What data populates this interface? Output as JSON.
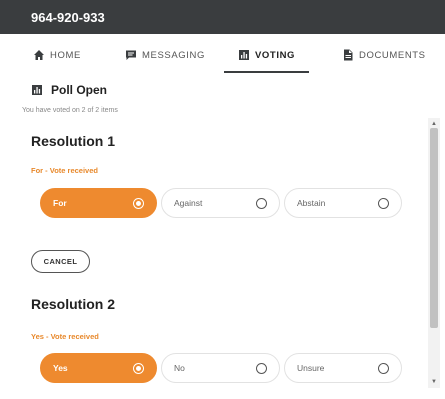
{
  "window": {
    "title": "964-920-933"
  },
  "tabs": [
    {
      "label": "HOME",
      "icon": "home-icon"
    },
    {
      "label": "MESSAGING",
      "icon": "chat-icon"
    },
    {
      "label": "VOTING",
      "icon": "bar-chart-icon",
      "active": true
    },
    {
      "label": "DOCUMENTS",
      "icon": "document-icon"
    }
  ],
  "poll": {
    "status": "Poll Open",
    "voted_note": "You have voted on 2 of 2 items",
    "accent_color": "#ee8a2f"
  },
  "resolutions": [
    {
      "title": "Resolution 1",
      "status": "For - Vote received",
      "options": [
        {
          "label": "For",
          "selected": true
        },
        {
          "label": "Against",
          "selected": false
        },
        {
          "label": "Abstain",
          "selected": false
        }
      ]
    },
    {
      "title": "Resolution 2",
      "status": "Yes - Vote received",
      "options": [
        {
          "label": "Yes",
          "selected": true
        },
        {
          "label": "No",
          "selected": false
        },
        {
          "label": "Unsure",
          "selected": false
        }
      ]
    }
  ],
  "actions": {
    "cancel_label": "CANCEL"
  }
}
